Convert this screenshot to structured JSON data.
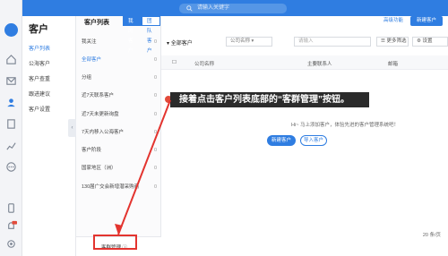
{
  "search": {
    "placeholder": "请输入关键字"
  },
  "sidebar": {
    "title": "客户",
    "items": [
      {
        "label": "客户列表"
      },
      {
        "label": "公海客户"
      },
      {
        "label": "客户查重"
      },
      {
        "label": "跟进建议"
      },
      {
        "label": "客户设置"
      }
    ]
  },
  "list_panel": {
    "title": "客户列表",
    "tabs": [
      {
        "label": "我的客户"
      },
      {
        "label": "团队客户"
      }
    ],
    "items": [
      {
        "label": "我关注",
        "count": "0"
      },
      {
        "label": "全部客户",
        "count": "0"
      },
      {
        "label": "分组",
        "count": "0"
      },
      {
        "label": "近7天联系客户",
        "count": "0"
      },
      {
        "label": "近7天未更新询盘",
        "count": "0"
      },
      {
        "label": "7天内移入公海客户",
        "count": "0"
      },
      {
        "label": "客户阶段",
        "count": "0"
      },
      {
        "label": "国家地区（洲）",
        "count": "0"
      },
      {
        "label": "130届广交会新增潜采购商",
        "count": "0"
      }
    ],
    "footer_label": "客群管理 ⓘ"
  },
  "main": {
    "top_links": {
      "advanced": "高级功能",
      "new_customer": "新建客户"
    },
    "filter": {
      "label": "全部客户",
      "select": "公司名称",
      "input_placeholder": "请输入",
      "more_filter": "更多筛选",
      "settings": "设置"
    },
    "table_headers": [
      "公司名称",
      "主要联系人",
      "邮箱"
    ],
    "empty_text": "Hi~ 马上添加客户，体验先进的客户管理系统吧！",
    "buttons": {
      "new": "新建客户",
      "import": "导入客户"
    },
    "page_size": "20 条/页"
  },
  "caption": "接着点击客户列表底部的“客群管理”按钮。",
  "colors": {
    "accent": "#2f7de1",
    "highlight": "#e3342f"
  }
}
